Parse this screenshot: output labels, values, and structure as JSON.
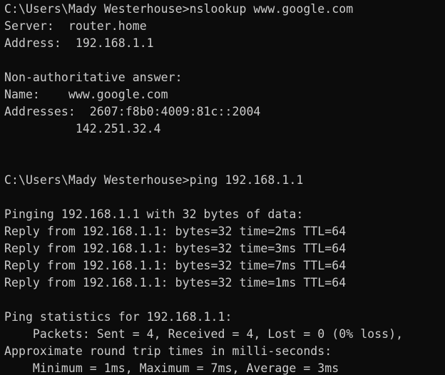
{
  "terminal": {
    "lines": [
      "C:\\Users\\Mady Westerhouse>nslookup www.google.com",
      "Server:  router.home",
      "Address:  192.168.1.1",
      "",
      "Non-authoritative answer:",
      "Name:    www.google.com",
      "Addresses:  2607:f8b0:4009:81c::2004",
      "          142.251.32.4",
      "",
      "",
      "C:\\Users\\Mady Westerhouse>ping 192.168.1.1",
      "",
      "Pinging 192.168.1.1 with 32 bytes of data:",
      "Reply from 192.168.1.1: bytes=32 time=2ms TTL=64",
      "Reply from 192.168.1.1: bytes=32 time=3ms TTL=64",
      "Reply from 192.168.1.1: bytes=32 time=7ms TTL=64",
      "Reply from 192.168.1.1: bytes=32 time=1ms TTL=64",
      "",
      "Ping statistics for 192.168.1.1:",
      "    Packets: Sent = 4, Received = 4, Lost = 0 (0% loss),",
      "Approximate round trip times in milli-seconds:",
      "    Minimum = 1ms, Maximum = 7ms, Average = 3ms"
    ]
  },
  "colors": {
    "background": "#0c0c0c",
    "text": "#cccccc"
  }
}
